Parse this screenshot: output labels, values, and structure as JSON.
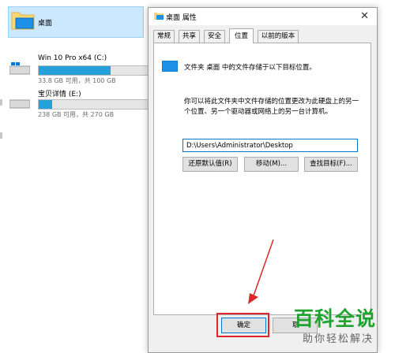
{
  "explorer": {
    "folder_label": "桌面",
    "drives": [
      {
        "name": "Win 10 Pro x64 (C:)",
        "size": "33.8 GB 可用，共 100 GB",
        "used_fraction": 0.66
      },
      {
        "name": "宝贝详情 (E:)",
        "size": "238 GB 可用，共 270 GB",
        "used_fraction": 0.12
      }
    ]
  },
  "dialog": {
    "title": "桌面 属性",
    "close_glyph": "✕",
    "tabs": [
      "常规",
      "共享",
      "安全",
      "位置",
      "以前的版本"
    ],
    "active_tab": "位置",
    "location_line": "文件夹 桌面 中的文件存储于以下目标位置。",
    "description": "你可以将此文件夹中文件存储的位置更改为此硬盘上的另一个位置、另一个驱动器或网络上的另一台计算机。",
    "path_value": "D:\\Users\\Administrator\\Desktop",
    "buttons": {
      "restore": "还原默认值(R)",
      "move": "移动(M)...",
      "find_target": "查找目标(F)...",
      "ok": "确定",
      "cancel": "取"
    }
  },
  "watermark": {
    "title": "百科全说",
    "subtitle": "助你轻松解决"
  },
  "colors": {
    "selection_bg": "#cce8ff",
    "drive_bar": "#26a0da",
    "highlight_red": "#e0242b",
    "watermark_green": "#1fa32f"
  }
}
